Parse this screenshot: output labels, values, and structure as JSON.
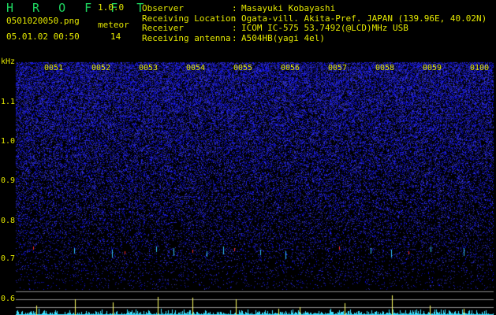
{
  "header": {
    "app_title": "H R O F F T",
    "app_version": "1.0.0",
    "filename": "0501020050.png",
    "meteor_label": "meteor",
    "datetime": "05.01.02 00:50",
    "meteor_count": "14"
  },
  "info": [
    {
      "label": "Observer",
      "sep": ":",
      "value": "Masayuki Kobayashi"
    },
    {
      "label": "Receiving Location",
      "sep": ":",
      "value": "Ogata-vill. Akita-Pref. JAPAN (139.96E, 40.02N)"
    },
    {
      "label": "Receiver",
      "sep": ":",
      "value": "ICOM IC-575 53.7492(@LCD)MHz USB"
    },
    {
      "label": "Receiving antenna",
      "sep": ":",
      "value": "A504HB(yagi 4el)"
    }
  ],
  "axis": {
    "unit": "kHz",
    "ticks": [
      "1.1",
      "1.0",
      "0.9",
      "0.8",
      "0.7",
      "0.6"
    ]
  },
  "time_marks": [
    "0051",
    "0052",
    "0053",
    "0054",
    "0055",
    "0056",
    "0057",
    "0058",
    "0059",
    "0100"
  ],
  "colors": {
    "background": "#000000",
    "text": "#e4e800",
    "title": "#1ed760",
    "noise": "#2a2ad8",
    "meteor_red": "#ff3030",
    "meteor_cyan": "#30c0ff",
    "signal_bar": "#ffff60",
    "baseline": "#40e0ff"
  }
}
